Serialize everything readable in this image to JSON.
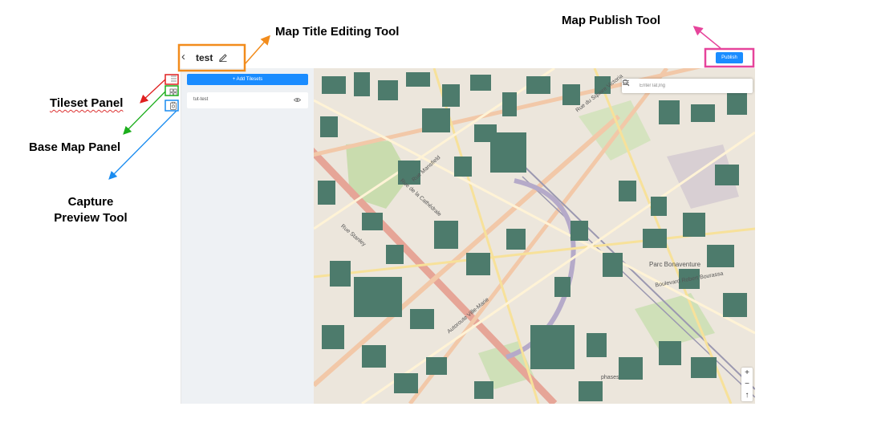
{
  "annotations": {
    "title_tool": "Map Title Editing Tool",
    "publish_tool": "Map Publish Tool",
    "tileset_panel": "Tileset Panel",
    "base_map_panel": "Base Map Panel",
    "capture_preview": [
      "Capture",
      "Preview Tool"
    ]
  },
  "header": {
    "title": "test",
    "publish_label": "Publish"
  },
  "panel": {
    "add_tilesets_label": "+ Add Tilesets",
    "tilesets": [
      {
        "name": "tut-test"
      }
    ]
  },
  "map": {
    "search_placeholder": "Enter lat,lng",
    "labels": {
      "rue_mansfield": "Rue Mansfield",
      "rue_cathedrale": "Rue de la Cathédrale",
      "rue_stanley": "Rue Stanley",
      "parc_bonaventure": "Parc Bonaventure",
      "boulevard_bourassa": "Boulevard Robert Bourassa",
      "autoroute": "Autoroute Ville-Marie",
      "square_victoria": "Rue du Square Victoria",
      "phases": "phases"
    },
    "zoom_in": "+",
    "zoom_out": "−",
    "compass": "↑"
  },
  "colors": {
    "accent": "#1a8cff",
    "highlight_title": "#f28c1c",
    "highlight_publish": "#e6449b",
    "arrow_tileset": "#e02020",
    "arrow_basemap": "#1cae1c",
    "arrow_capture": "#1a8cf0",
    "building": "#4d7b6c",
    "park": "#c9dcae"
  },
  "icons": [
    "back-icon",
    "edit-icon",
    "tileset-list-icon",
    "grid-icon",
    "capture-icon",
    "eye-icon",
    "menu-icon",
    "search-icon"
  ]
}
